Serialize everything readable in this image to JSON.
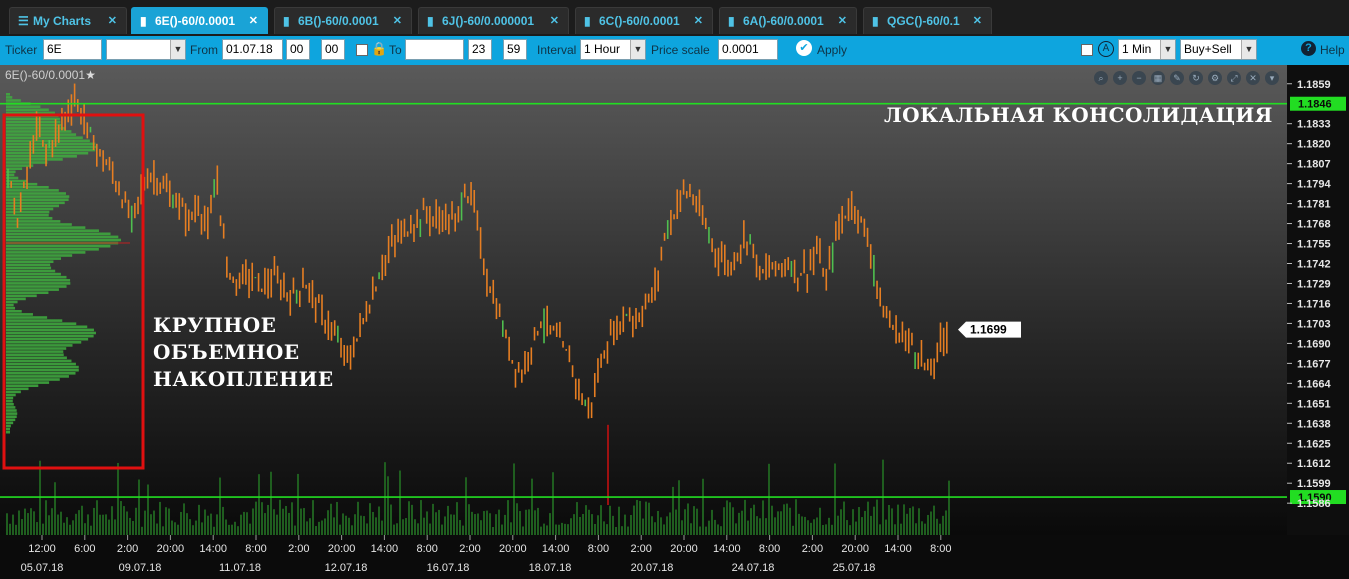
{
  "tabs": [
    {
      "label": "My Charts",
      "icon": "menu-icon",
      "active": false
    },
    {
      "label": "6E()-60/0.0001",
      "icon": "bar-chart-icon",
      "active": true
    },
    {
      "label": "6B()-60/0.0001",
      "icon": "bar-chart-icon",
      "active": false
    },
    {
      "label": "6J()-60/0.000001",
      "icon": "bar-chart-icon",
      "active": false
    },
    {
      "label": "6C()-60/0.0001",
      "icon": "bar-chart-icon",
      "active": false
    },
    {
      "label": "6A()-60/0.0001",
      "icon": "bar-chart-icon",
      "active": false
    },
    {
      "label": "QGC()-60/0.1",
      "icon": "bar-chart-icon",
      "active": false
    }
  ],
  "toolbar": {
    "ticker_label": "Ticker",
    "ticker_value": "6E",
    "ticker_select": "",
    "from_label": "From",
    "from_date": "01.07.18",
    "from_hour": "00",
    "from_minute": "00",
    "to_label": "To",
    "to_date": "",
    "to_hour": "23",
    "to_minute": "59",
    "interval_label": "Interval",
    "interval_value": "1 Hour",
    "price_scale_label": "Price scale",
    "price_scale_value": "0.0001",
    "apply_label": "Apply",
    "timeframe_value": "1 Min",
    "side_value": "Buy+Sell",
    "help_label": "Help"
  },
  "chart": {
    "title": "6E()-60/0.0001",
    "last_price": "1.1699",
    "resistance_label": "1.1846",
    "support_label": "1.1590",
    "annotation_top": "ЛОКАЛЬНАЯ КОНСОЛИДАЦИЯ",
    "annotation_left": [
      "КРУПНОЕ",
      "ОБЪЕМНОЕ",
      "НАКОПЛЕНИЕ"
    ],
    "colors": {
      "bars": "#e67e22",
      "level": "#22dd22",
      "volume": "#1f5e1f",
      "profile": "#3fae3f"
    }
  },
  "chart_data": {
    "type": "bar",
    "ylim": [
      1.1577,
      1.1866
    ],
    "y_ticks": [
      "1.1859",
      "1.1846",
      "1.1833",
      "1.1820",
      "1.1807",
      "1.1794",
      "1.1781",
      "1.1768",
      "1.1755",
      "1.1742",
      "1.1729",
      "1.1716",
      "1.1703",
      "1.1690",
      "1.1677",
      "1.1664",
      "1.1651",
      "1.1638",
      "1.1625",
      "1.1612",
      "1.1599",
      "1.1590",
      "1.1586"
    ],
    "x_time_labels": [
      "12:00",
      "6:00",
      "2:00",
      "20:00",
      "14:00",
      "8:00",
      "2:00",
      "20:00",
      "14:00",
      "8:00",
      "2:00",
      "20:00",
      "14:00",
      "8:00",
      "2:00",
      "20:00",
      "14:00",
      "8:00",
      "2:00",
      "20:00",
      "14:00",
      "8:00"
    ],
    "x_date_labels": [
      "05.07.18",
      "09.07.18",
      "11.07.18",
      "12.07.18",
      "16.07.18",
      "18.07.18",
      "20.07.18",
      "24.07.18",
      "25.07.18"
    ],
    "levels": [
      1.1846,
      1.159
    ],
    "last": 1.1699,
    "close_path": [
      1.18,
      1.177,
      1.18,
      1.183,
      1.1815,
      1.1825,
      1.1838,
      1.185,
      1.1835,
      1.182,
      1.181,
      1.18,
      1.1785,
      1.177,
      1.179,
      1.18,
      1.1795,
      1.1785,
      1.178,
      1.177,
      1.178,
      1.1765,
      1.1795,
      1.174,
      1.173,
      1.1735,
      1.173,
      1.1728,
      1.1732,
      1.1725,
      1.172,
      1.173,
      1.1722,
      1.1708,
      1.17,
      1.1685,
      1.168,
      1.17,
      1.1715,
      1.1735,
      1.175,
      1.176,
      1.1765,
      1.177,
      1.1775,
      1.177,
      1.1772,
      1.1768,
      1.179,
      1.178,
      1.174,
      1.172,
      1.17,
      1.168,
      1.167,
      1.169,
      1.1705,
      1.17,
      1.169,
      1.168,
      1.166,
      1.1645,
      1.167,
      1.169,
      1.17,
      1.171,
      1.1705,
      1.1715,
      1.1725,
      1.176,
      1.1775,
      1.179,
      1.1785,
      1.177,
      1.1755,
      1.1745,
      1.174,
      1.1755,
      1.176,
      1.1735,
      1.1738,
      1.174,
      1.1742,
      1.1736,
      1.1738,
      1.175,
      1.173,
      1.176,
      1.1775,
      1.178,
      1.1765,
      1.174,
      1.171,
      1.17,
      1.1695,
      1.169,
      1.168,
      1.167,
      1.169,
      1.17
    ]
  }
}
